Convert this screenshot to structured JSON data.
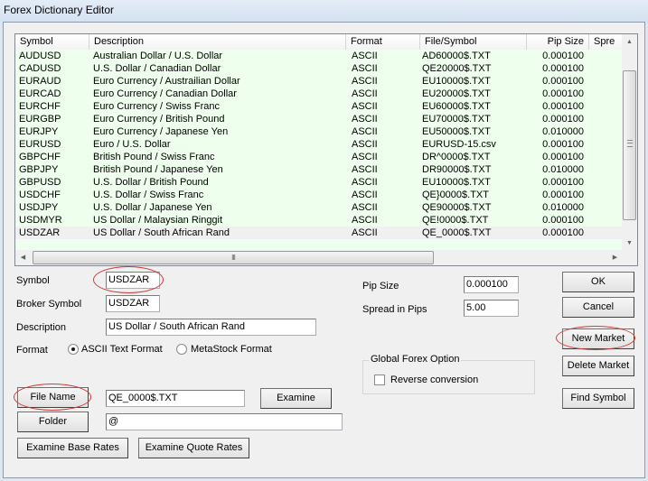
{
  "window": {
    "title": "Forex Dictionary Editor"
  },
  "list": {
    "columns": [
      {
        "label": "Symbol"
      },
      {
        "label": "Description"
      },
      {
        "label": "Format"
      },
      {
        "label": "File/Symbol"
      },
      {
        "label": "Pip Size"
      },
      {
        "label": "Spre"
      }
    ],
    "rows": [
      {
        "symbol": "AUDUSD",
        "description": "Australian Dollar / U.S. Dollar",
        "format": "ASCII",
        "file": "AD60000$.TXT",
        "pip": "0.000100"
      },
      {
        "symbol": "CADUSD",
        "description": "U.S. Dollar / Canadian Dollar",
        "format": "ASCII",
        "file": "QE20000$.TXT",
        "pip": "0.000100"
      },
      {
        "symbol": "EURAUD",
        "description": "Euro Currency / Austrailian Dollar",
        "format": "ASCII",
        "file": "EU10000$.TXT",
        "pip": "0.000100"
      },
      {
        "symbol": "EURCAD",
        "description": "Euro Currency / Canadian Dollar",
        "format": "ASCII",
        "file": "EU20000$.TXT",
        "pip": "0.000100"
      },
      {
        "symbol": "EURCHF",
        "description": "Euro Currency / Swiss Franc",
        "format": "ASCII",
        "file": "EU60000$.TXT",
        "pip": "0.000100"
      },
      {
        "symbol": "EURGBP",
        "description": "Euro Currency / British Pound",
        "format": "ASCII",
        "file": "EU70000$.TXT",
        "pip": "0.000100"
      },
      {
        "symbol": "EURJPY",
        "description": "Euro Currency / Japanese Yen",
        "format": "ASCII",
        "file": "EU50000$.TXT",
        "pip": "0.010000"
      },
      {
        "symbol": "EURUSD",
        "description": "Euro / U.S. Dollar",
        "format": "ASCII",
        "file": "EURUSD-15.csv",
        "pip": "0.000100"
      },
      {
        "symbol": "GBPCHF",
        "description": "British Pound / Swiss Franc",
        "format": "ASCII",
        "file": "DR^0000$.TXT",
        "pip": "0.000100"
      },
      {
        "symbol": "GBPJPY",
        "description": "British Pound / Japanese Yen",
        "format": "ASCII",
        "file": "DR90000$.TXT",
        "pip": "0.010000"
      },
      {
        "symbol": "GBPUSD",
        "description": "U.S. Dollar / British Pound",
        "format": "ASCII",
        "file": "EU10000$.TXT",
        "pip": "0.000100"
      },
      {
        "symbol": "USDCHF",
        "description": "U.S. Dollar / Swiss Franc",
        "format": "ASCII",
        "file": "QE}0000$.TXT",
        "pip": "0.000100"
      },
      {
        "symbol": "USDJPY",
        "description": "U.S. Dollar / Japanese Yen",
        "format": "ASCII",
        "file": "QE90000$.TXT",
        "pip": "0.010000"
      },
      {
        "symbol": "USDMYR",
        "description": "US Dollar / Malaysian Ringgit",
        "format": "ASCII",
        "file": "QE!0000$.TXT",
        "pip": "0.000100"
      },
      {
        "symbol": "USDZAR",
        "description": "US Dollar / South African Rand",
        "format": "ASCII",
        "file": "QE_0000$.TXT",
        "pip": "0.000100"
      }
    ],
    "selected_index": 14,
    "background_color": "#eeffee",
    "hscroll_grip": "III"
  },
  "form": {
    "symbol_label": "Symbol",
    "symbol_value": "USDZAR",
    "broker_symbol_label": "Broker Symbol",
    "broker_symbol_value": "USDZAR",
    "description_label": "Description",
    "description_value": "US Dollar / South African Rand",
    "format_label": "Format",
    "format_ascii_label": "ASCII Text Format",
    "format_metastock_label": "MetaStock Format",
    "format_selected": "ASCII Text Format",
    "pip_size_label": "Pip Size",
    "pip_size_value": "0.000100",
    "spread_label": "Spread in Pips",
    "spread_value": "5.00",
    "file_name_button": "File Name",
    "file_name_value": "QE_0000$.TXT",
    "examine_button": "Examine",
    "folder_button": "Folder",
    "folder_value": "@",
    "examine_base_button": "Examine Base Rates",
    "examine_quote_button": "Examine  Quote Rates"
  },
  "global_option": {
    "title": "Global Forex Option",
    "reverse_label": "Reverse conversion",
    "reverse_checked": false
  },
  "buttons": {
    "ok": "OK",
    "cancel": "Cancel",
    "new_market": "New Market",
    "delete_market": "Delete Market",
    "find_symbol": "Find Symbol"
  },
  "annotation_color": "#d33a3a"
}
